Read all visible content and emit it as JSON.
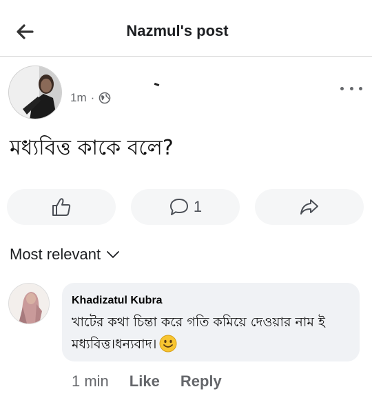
{
  "header": {
    "title": "Nazmul's post",
    "back_icon": "arrow-left-icon"
  },
  "post": {
    "time": "1m",
    "separator": "·",
    "privacy_icon": "globe-icon",
    "text": "মধ্যবিত্ত কাকে বলে?",
    "comment_count": "1"
  },
  "actions": {
    "like_icon": "thumbs-up-icon",
    "comment_icon": "comment-bubble-icon",
    "share_icon": "share-arrow-icon"
  },
  "sort": {
    "label": "Most relevant",
    "icon": "chevron-down-icon"
  },
  "comment": {
    "author": "Khadizatul Kubra",
    "text": "খাটের কথা চিন্তা করে গতি কমিয়ে দেওয়ার নাম ই মধ্যবিত্ত।ধন্যবাদ।",
    "emoji_icon": "smiling-face-emoji",
    "time": "1 min",
    "like_label": "Like",
    "reply_label": "Reply"
  },
  "colors": {
    "text_primary": "#1c1e21",
    "text_secondary": "#65676b",
    "bubble_bg": "#f0f2f5",
    "action_bg": "#f5f6f7",
    "divider": "#d4d4d4"
  }
}
